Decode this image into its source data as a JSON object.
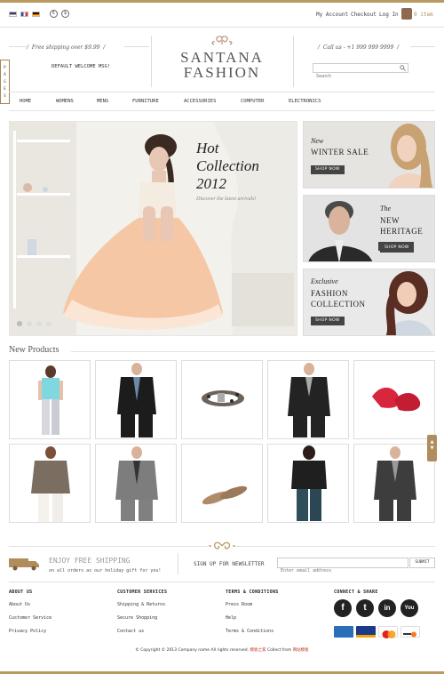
{
  "topbar": {
    "languages": [
      "English",
      "French",
      "German"
    ],
    "currencies": [
      "€",
      "$"
    ],
    "links": [
      "My Account",
      "Checkout",
      "Log In"
    ],
    "cart": "0 item"
  },
  "header": {
    "shipping": "Free shipping over $9.99",
    "welcome": "DEFAULT WELCOME MSG!",
    "brand_line1": "SANTANA",
    "brand_line2": "FASHION",
    "call": "Call us - +1 999 999 9999",
    "search_placeholder": "Search"
  },
  "side_tab": [
    "P",
    "A",
    "G",
    "E",
    "S"
  ],
  "nav": [
    "HOME",
    "WOMENS",
    "MENS",
    "FURNITURE",
    "ACCESSORIES",
    "COMPUTER",
    "ELECTRONICS"
  ],
  "hero": {
    "line1": "Hot",
    "line2": "Collection",
    "line3": "2012",
    "sub": "Discover the latest arrivals!"
  },
  "promos": [
    {
      "lead": "New",
      "main": "WINTER SALE",
      "cta": "SHOP NOW"
    },
    {
      "lead": "The",
      "main1": "NEW",
      "main2": "HERITAGE",
      "cta": "SHOP NOW"
    },
    {
      "lead": "Exclusive",
      "main1": "FASHION",
      "main2": "COLLECTION",
      "cta": "SHOP NOW"
    }
  ],
  "products_title": "New Products",
  "products": [
    "womens-outfit-cyan-top",
    "mens-black-suit",
    "leopard-belt",
    "mens-black-suit-2",
    "red-shoes",
    "womens-sweater",
    "mens-grey-suit",
    "leopard-flats",
    "womens-black-tee",
    "mens-charcoal-suit"
  ],
  "newsletter": {
    "title": "ENJOY FREE SHIPPING",
    "sub": "on all orders as our holiday gift for you!",
    "label": "SIGN UP FOR NEWSLETTER",
    "placeholder": "Enter email address",
    "button": "SUBMIT"
  },
  "footer": {
    "about": {
      "title": "ABOUT US",
      "links": [
        "About Us",
        "Customer Service",
        "Privacy Policy"
      ]
    },
    "service": {
      "title": "CUSTOMER SERVICES",
      "links": [
        "Shipping & Returns",
        "Secure Shopping",
        "Contact us"
      ]
    },
    "terms": {
      "title": "TERMS & CONDITIONS",
      "links": [
        "Press Room",
        "Help",
        "Terms & Conditions"
      ]
    },
    "connect": {
      "title": "CONNECT & SHARE",
      "icons": [
        "f",
        "t",
        "in",
        "You"
      ]
    },
    "cards": [
      "AMERICAN EXPRESS",
      "VISA",
      "MasterCard",
      "DISCOVER"
    ],
    "copyright": "© Copyright © 2013 Company name All rights reserved.",
    "collect1": "模板之家",
    "collect_mid": "Collect from",
    "collect2": "网站模板"
  },
  "colors": {
    "gold": "#b89a5e",
    "dark": "#222222",
    "button": "#444444"
  }
}
